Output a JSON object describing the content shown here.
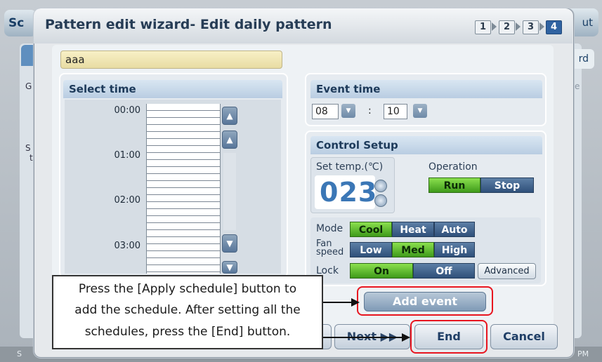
{
  "background": {
    "title_left": "Sc",
    "title_right": "ut",
    "side_button": "rd",
    "letters": [
      "G",
      "S",
      "t"
    ],
    "right_letter": "e",
    "bottom_left": "S",
    "bottom_right": "PM"
  },
  "dialog": {
    "title": "Pattern edit wizard- Edit daily pattern",
    "steps": [
      "1",
      "2",
      "3",
      "4"
    ],
    "active_step": "4"
  },
  "pattern_name": "aaa",
  "select_time": {
    "title": "Select time",
    "times": [
      "00:00",
      "01:00",
      "02:00",
      "03:00"
    ]
  },
  "event_time": {
    "title": "Event  time",
    "hour": "08",
    "separator": ":",
    "minute": "10"
  },
  "control_setup": {
    "title": "Control Setup",
    "set_temp_label": "Set temp.(℃)",
    "temp_value": "023",
    "operation_label": "Operation",
    "operation": [
      "Run",
      "Stop"
    ],
    "operation_selected": "Run",
    "mode_label": "Mode",
    "mode": [
      "Cool",
      "Heat",
      "Auto"
    ],
    "mode_selected": "Cool",
    "fan_label_1": "Fan",
    "fan_label_2": "speed",
    "fan": [
      "Low",
      "Med",
      "High"
    ],
    "fan_selected": "Med",
    "lock_label": "Lock",
    "lock": [
      "On",
      "Off"
    ],
    "lock_selected": "On",
    "advanced": "Advanced"
  },
  "buttons": {
    "add_event": "Add event",
    "next": "Next ▶▶",
    "end": "End",
    "cancel": "Cancel"
  },
  "callout": {
    "lines": [
      "Press the [Apply schedule] button to",
      "add the schedule. After setting all the",
      "schedules, press the [End] button."
    ]
  },
  "colors": {
    "active_step": "#2f62a1",
    "selected_segment": "#5bbf2c",
    "highlight_ring": "#e8151f"
  }
}
